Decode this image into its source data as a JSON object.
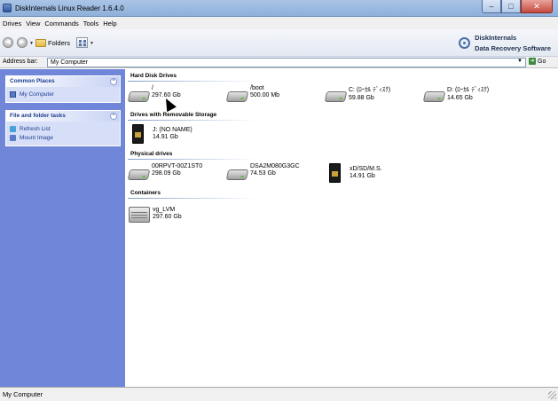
{
  "window": {
    "title": "DiskInternals Linux Reader 1.6.4.0"
  },
  "menu": {
    "items": [
      "Drives",
      "View",
      "Commands",
      "Tools",
      "Help"
    ]
  },
  "toolbar": {
    "folders_label": "Folders"
  },
  "brand": {
    "line1": "DiskInternals",
    "line2": "Data Recovery Software"
  },
  "address": {
    "label": "Address bar:",
    "value": "My Computer",
    "go_label": "Go"
  },
  "left_panel": {
    "common_places": {
      "title": "Common Places",
      "links": [
        "My Computer"
      ]
    },
    "file_tasks": {
      "title": "File and folder tasks",
      "links": [
        "Refresh List",
        "Mount Image"
      ]
    }
  },
  "groups": {
    "hard_disk": {
      "title": "Hard Disk Drives",
      "items": [
        {
          "name": "/",
          "size": "297.60 Gb"
        },
        {
          "name": "/boot",
          "size": "500.00 Mb"
        },
        {
          "name": "C: (ﾛｰｶﾙ ﾃﾞｨｽｸ)",
          "size": "59.88 Gb"
        },
        {
          "name": "D: (ﾛｰｶﾙ ﾃﾞｨｽｸ)",
          "size": "14.65 Gb"
        }
      ]
    },
    "removable": {
      "title": "Drives with Removable Storage",
      "items": [
        {
          "name": "J: (NO NAME)",
          "size": "14.91 Gb"
        }
      ]
    },
    "physical": {
      "title": "Physical drives",
      "items": [
        {
          "name": "00RPVT-00Z1ST0",
          "size": "298.09 Gb"
        },
        {
          "name": "DSA2M080G3GC",
          "size": "74.53 Gb"
        },
        {
          "name": "xD/SD/M.S.",
          "size": "14.91 Gb"
        }
      ]
    },
    "containers": {
      "title": "Containers",
      "items": [
        {
          "name": "vg_LVM",
          "size": "297.60 Gb"
        }
      ]
    }
  },
  "status": {
    "text": "My Computer"
  },
  "colors": {
    "left_pane": "#7086d8",
    "panel_bg": "#d6dff7",
    "link": "#1d3d8f"
  }
}
